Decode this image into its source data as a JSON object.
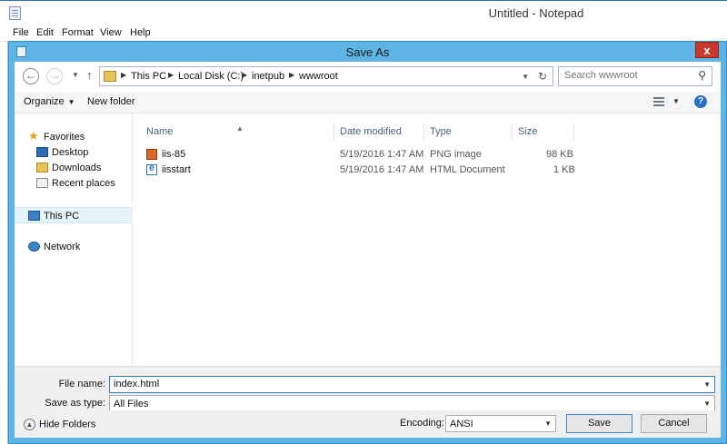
{
  "notepad": {
    "title": "Untitled - Notepad",
    "menu": [
      "File",
      "Edit",
      "Format",
      "View",
      "Help"
    ]
  },
  "dialog": {
    "title": "Save As",
    "close_label": "x",
    "breadcrumb": [
      "This PC",
      "Local Disk (C:)",
      "inetpub",
      "wwwroot"
    ],
    "search_placeholder": "Search wwwroot",
    "toolbar": {
      "organize_label": "Organize",
      "new_folder_label": "New folder"
    },
    "nav_pane": {
      "favorites_label": "Favorites",
      "favorites_items": [
        "Desktop",
        "Downloads",
        "Recent places"
      ],
      "this_pc_label": "This PC",
      "network_label": "Network"
    },
    "columns": [
      "Name",
      "Date modified",
      "Type",
      "Size"
    ],
    "files": [
      {
        "name": "iis-85",
        "date": "5/19/2016 1:47 AM",
        "type": "PNG image",
        "size": "98 KB",
        "icon": "png-file-icon"
      },
      {
        "name": "iisstart",
        "date": "5/19/2016 1:47 AM",
        "type": "HTML Document",
        "size": "1 KB",
        "icon": "html-file-icon"
      }
    ],
    "form": {
      "file_name_label": "File name:",
      "file_name_value": "index.html",
      "save_as_type_label": "Save as type:",
      "save_as_type_value": "All Files",
      "encoding_label": "Encoding:",
      "encoding_value": "ANSI"
    },
    "buttons": {
      "hide_folders_label": "Hide Folders",
      "save_label": "Save",
      "cancel_label": "Cancel"
    }
  },
  "colors": {
    "dialog_frame": "#5eb5e5",
    "close_button": "#c7392b",
    "selected_nav": "#e5f3fb",
    "focus_border": "#2b7dd0"
  }
}
